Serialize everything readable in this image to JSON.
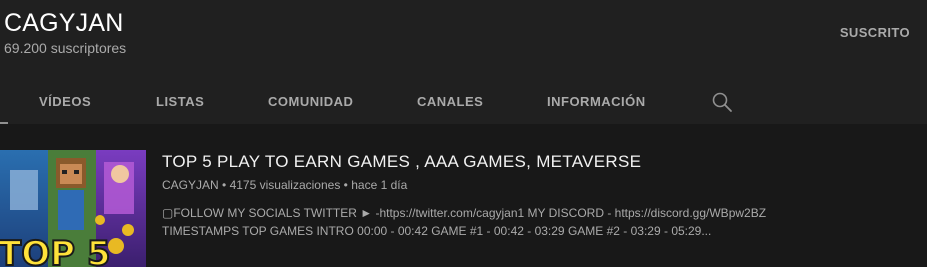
{
  "channel": {
    "name": "CAGYJAN",
    "subscribers": "69.200 suscriptores",
    "subscribe_button": "SUSCRITO"
  },
  "tabs": [
    {
      "label": "VÍDEOS",
      "active": true
    },
    {
      "label": "LISTAS"
    },
    {
      "label": "COMUNIDAD"
    },
    {
      "label": "CANALES"
    },
    {
      "label": "INFORMACIÓN"
    }
  ],
  "icons": {
    "search": "search-icon"
  },
  "video": {
    "title": "TOP 5 PLAY TO EARN GAMES , AAA GAMES, METAVERSE",
    "channel": "CAGYJAN",
    "views": "4175 visualizaciones",
    "separator": "•",
    "age": "hace 1 día",
    "description_line1": "▢FOLLOW MY SOCIALS TWITTER ► -https://twitter.com/cagyjan1 MY DISCORD - https://discord.gg/WBpw2BZ",
    "description_line2": "TIMESTAMPS TOP GAMES INTRO 00:00 - 00:42 GAME #1 - 00:42 - 03:29 GAME #2 - 03:29 - 05:29...",
    "thumbnail_text": "TOP 5"
  },
  "colors": {
    "page_bg": "#181818",
    "header_bg": "#202020",
    "text_primary": "#f1f1f1",
    "text_secondary": "#aaaaaa"
  }
}
